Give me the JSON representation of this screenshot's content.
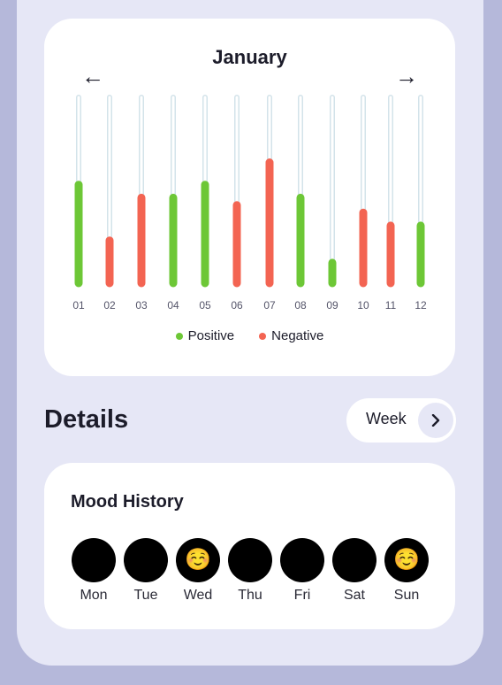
{
  "chart": {
    "title": "January",
    "prev_icon": "←",
    "next_icon": "→"
  },
  "chart_data": {
    "type": "bar",
    "categories": [
      "01",
      "02",
      "03",
      "04",
      "05",
      "06",
      "07",
      "08",
      "09",
      "10",
      "11",
      "12"
    ],
    "values": [
      0.53,
      0.23,
      0.46,
      0.46,
      0.53,
      0.42,
      0.65,
      0.46,
      0.11,
      0.38,
      0.31,
      0.31
    ],
    "sentiment": [
      "positive",
      "negative",
      "negative",
      "positive",
      "positive",
      "negative",
      "negative",
      "positive",
      "positive",
      "negative",
      "negative",
      "positive"
    ],
    "ylim": [
      0,
      1
    ],
    "legend": [
      {
        "label": "Positive",
        "color": "#6dc736"
      },
      {
        "label": "Negative",
        "color": "#f36452"
      }
    ],
    "track_color": "#d3e3ea"
  },
  "details": {
    "title": "Details",
    "range_label": "Week",
    "chevron_icon": "›"
  },
  "mood_history": {
    "title": "Mood History",
    "days": [
      {
        "label": "Mon",
        "emoji": "😢"
      },
      {
        "label": "Tue",
        "emoji": "😃"
      },
      {
        "label": "Wed",
        "emoji": "☺️"
      },
      {
        "label": "Thu",
        "emoji": "😢"
      },
      {
        "label": "Fri",
        "emoji": "😣"
      },
      {
        "label": "Sat",
        "emoji": "😣"
      },
      {
        "label": "Sun",
        "emoji": "☺️"
      }
    ]
  }
}
